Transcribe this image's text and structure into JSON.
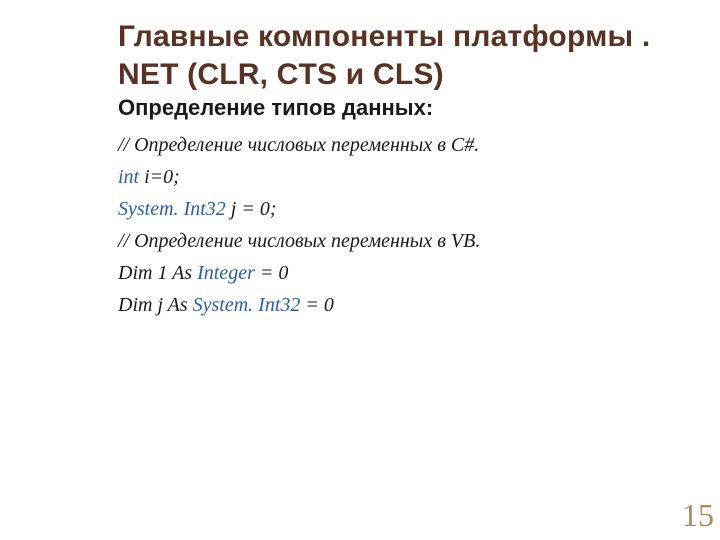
{
  "title": "Главные компоненты платформы . NET (CLR, CTS и CLS)",
  "subtitle": "Определение типов данных:",
  "lines": {
    "l1_pre": "// Определение числовых переменных в С#.",
    "l2_kw": "int",
    "l2_rest": " i=0;",
    "l3_kw": "System. Int32",
    "l3_rest": " j = 0;",
    "l4_pre": "// Определение числовых переменных в VB.",
    "l5_pre": "Dim 1 As ",
    "l5_kw": "Integer",
    "l5_rest": " = 0",
    "l6_pre": "Dim j As ",
    "l6_kw": "System. Int32",
    "l6_rest": " = 0"
  },
  "page": "15"
}
